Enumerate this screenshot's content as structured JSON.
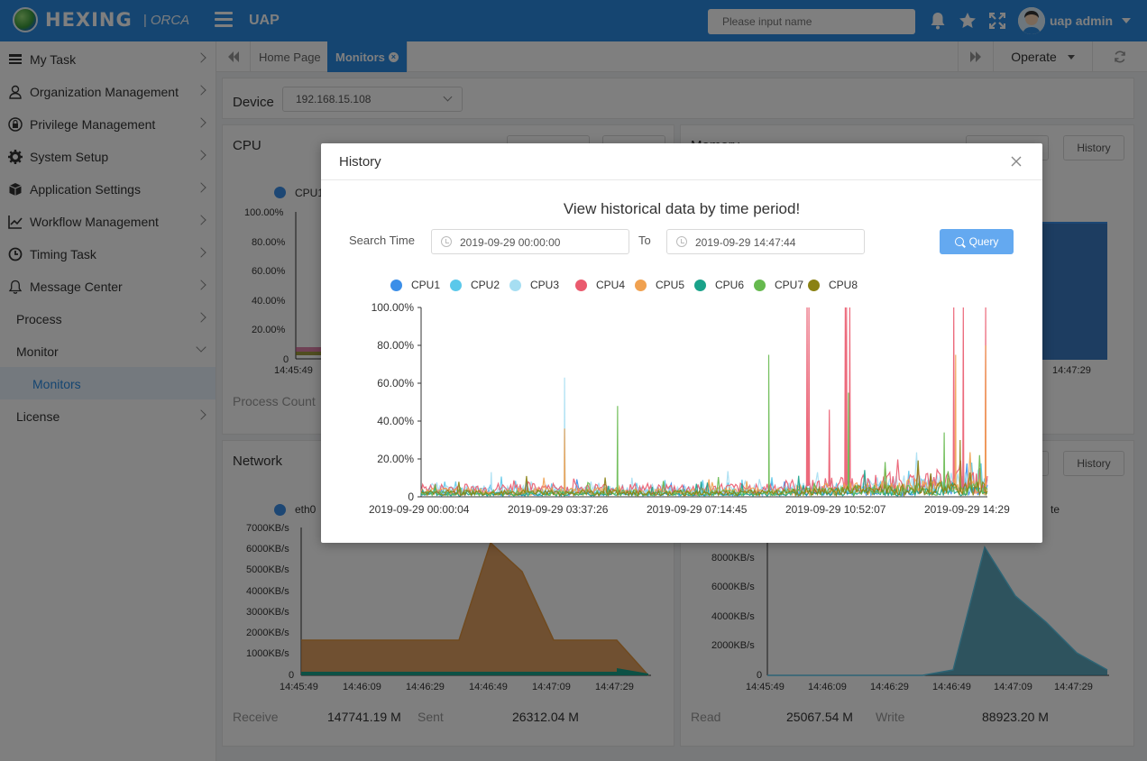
{
  "header": {
    "logo_text": "HEXING",
    "logo_sub": "| ORCA",
    "app_name": "UAP",
    "search_placeholder": "Please input name",
    "user_name": "uap admin"
  },
  "sidebar": {
    "items": [
      {
        "label": "My Task",
        "icon": "task-list-icon"
      },
      {
        "label": "Organization Management",
        "icon": "user-icon"
      },
      {
        "label": "Privilege Management",
        "icon": "lock-icon"
      },
      {
        "label": "System Setup",
        "icon": "gear-icon"
      },
      {
        "label": "Application Settings",
        "icon": "cube-icon"
      },
      {
        "label": "Workflow Management",
        "icon": "line-chart-icon"
      },
      {
        "label": "Timing Task",
        "icon": "clock-icon"
      },
      {
        "label": "Message Center",
        "icon": "bell-icon"
      },
      {
        "label": "Process"
      },
      {
        "label": "Monitor"
      },
      {
        "label": "Monitors"
      },
      {
        "label": "License"
      }
    ]
  },
  "tabs": {
    "home": "Home Page",
    "active": "Monitors",
    "operate": "Operate"
  },
  "main": {
    "device_label": "Device",
    "device_value": "192.168.15.108",
    "cpu": {
      "title": "CPU",
      "legend": "CPU1",
      "yticks": [
        "100.00%",
        "80.00%",
        "60.00%",
        "40.00%",
        "20.00%",
        "0"
      ],
      "xtick": "14:45:49",
      "process_count_label": "Process Count"
    },
    "memory": {
      "title": "Memory",
      "history_label": "History",
      "xtick": "14:47:29"
    },
    "network": {
      "title": "Network",
      "legend": "eth0",
      "yticks": [
        "7000KB/s",
        "6000KB/s",
        "5000KB/s",
        "4000KB/s",
        "3000KB/s",
        "2000KB/s",
        "1000KB/s",
        "0"
      ],
      "xticks": [
        "14:45:49",
        "14:46:09",
        "14:46:29",
        "14:46:49",
        "14:47:09",
        "14:47:29"
      ],
      "receive_label": "Receive",
      "receive_value": "147741.19 M",
      "sent_label": "Sent",
      "sent_value": "26312.04 M"
    },
    "disk": {
      "history_label": "History",
      "legend_suffix": "te",
      "yticks": [
        "8000KB/s",
        "6000KB/s",
        "4000KB/s",
        "2000KB/s",
        "0"
      ],
      "xticks": [
        "14:45:49",
        "14:46:09",
        "14:46:29",
        "14:46:49",
        "14:47:09",
        "14:47:29"
      ],
      "read_label": "Read",
      "read_value": "25067.54 M",
      "write_label": "Write",
      "write_value": "88923.20 M"
    }
  },
  "modal": {
    "title": "History",
    "heading": "View historical data by time period!",
    "search_time_label": "Search Time",
    "start_time": "2019-09-29 00:00:00",
    "to_label": "To",
    "end_time": "2019-09-29 14:47:44",
    "query_label": "Query"
  },
  "chart_data": {
    "type": "line",
    "title": "",
    "xlabel": "",
    "ylabel": "",
    "ylim": [
      0,
      100
    ],
    "y_ticks": [
      "100.00%",
      "80.00%",
      "60.00%",
      "40.00%",
      "20.00%",
      "0"
    ],
    "x_ticks": [
      "2019-09-29 00:00:04",
      "2019-09-29 03:37:26",
      "2019-09-29 07:14:45",
      "2019-09-29 10:52:07",
      "2019-09-29 14:29"
    ],
    "legend_position": "top",
    "series": [
      {
        "name": "CPU1",
        "color": "#3b8ee8",
        "baseline": 3,
        "spikes": []
      },
      {
        "name": "CPU2",
        "color": "#5bc8ea",
        "baseline": 4,
        "spikes": []
      },
      {
        "name": "CPU3",
        "color": "#a6def2",
        "baseline": 5,
        "spikes": [
          [
            "2019-09-29 03:45",
            63
          ],
          [
            "2019-09-29 01:50",
            13
          ]
        ]
      },
      {
        "name": "CPU4",
        "color": "#ea5a6e",
        "baseline": 6,
        "spikes": [
          [
            "2019-09-29 10:05",
            100
          ],
          [
            "2019-09-29 10:08",
            100
          ],
          [
            "2019-09-29 11:05",
            100
          ],
          [
            "2019-09-29 11:07",
            100
          ],
          [
            "2019-09-29 11:12",
            100
          ],
          [
            "2019-09-29 13:55",
            100
          ],
          [
            "2019-09-29 14:10",
            100
          ],
          [
            "2019-09-29 14:45",
            100
          ],
          [
            "2019-09-29 10:40",
            46
          ]
        ]
      },
      {
        "name": "CPU5",
        "color": "#f0a150",
        "baseline": 4,
        "spikes": [
          [
            "2019-09-29 03:45",
            36
          ],
          [
            "2019-09-29 14:45",
            80
          ],
          [
            "2019-09-29 13:58",
            75
          ]
        ]
      },
      {
        "name": "CPU6",
        "color": "#1aa28a",
        "baseline": 2,
        "spikes": []
      },
      {
        "name": "CPU7",
        "color": "#66b94e",
        "baseline": 3,
        "spikes": [
          [
            "2019-09-29 05:08",
            48
          ],
          [
            "2019-09-29 09:05",
            75
          ],
          [
            "2019-09-29 11:10",
            55
          ],
          [
            "2019-09-29 13:40",
            34
          ]
        ]
      },
      {
        "name": "CPU8",
        "color": "#8a8112",
        "baseline": 3,
        "spikes": [
          [
            "2019-09-29 14:05",
            30
          ]
        ]
      }
    ]
  }
}
